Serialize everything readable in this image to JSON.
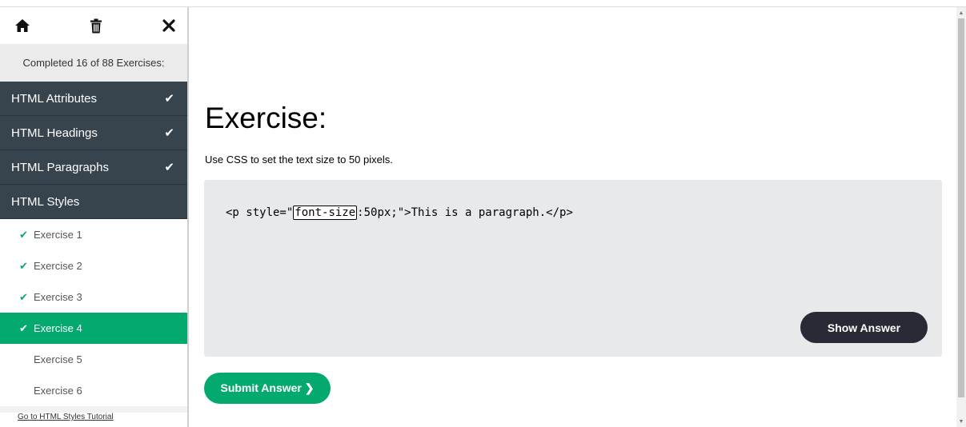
{
  "sidebar": {
    "top_icons": [
      "home-icon",
      "trash-icon",
      "close-icon"
    ],
    "progress_text": "Completed 16 of 88 Exercises:",
    "categories": [
      {
        "label": "HTML Attributes",
        "done": true
      },
      {
        "label": "HTML Headings",
        "done": true
      },
      {
        "label": "HTML Paragraphs",
        "done": true
      },
      {
        "label": "HTML Styles",
        "done": false
      }
    ],
    "exercises": [
      {
        "label": "Exercise 1",
        "done": true
      },
      {
        "label": "Exercise 2",
        "done": true
      },
      {
        "label": "Exercise 3",
        "done": true
      },
      {
        "label": "Exercise 4",
        "done": true,
        "active": true
      },
      {
        "label": "Exercise 5",
        "done": false
      },
      {
        "label": "Exercise 6",
        "done": false
      }
    ],
    "tutorial_link": "Go to HTML Styles Tutorial"
  },
  "main": {
    "title": "Exercise:",
    "instruction": "Use CSS to set the text size to 50 pixels.",
    "code": {
      "before": "<p style=\"",
      "answer_value": "font-size",
      "after": ":50px;\">This is a paragraph.</p>"
    },
    "show_answer_label": "Show Answer",
    "submit_label": "Submit Answer ❯"
  },
  "colors": {
    "sidebar_dark": "#38444d",
    "accent_green": "#04aa6d",
    "dark_button": "#282a35",
    "code_bg": "#e7e9eb"
  }
}
